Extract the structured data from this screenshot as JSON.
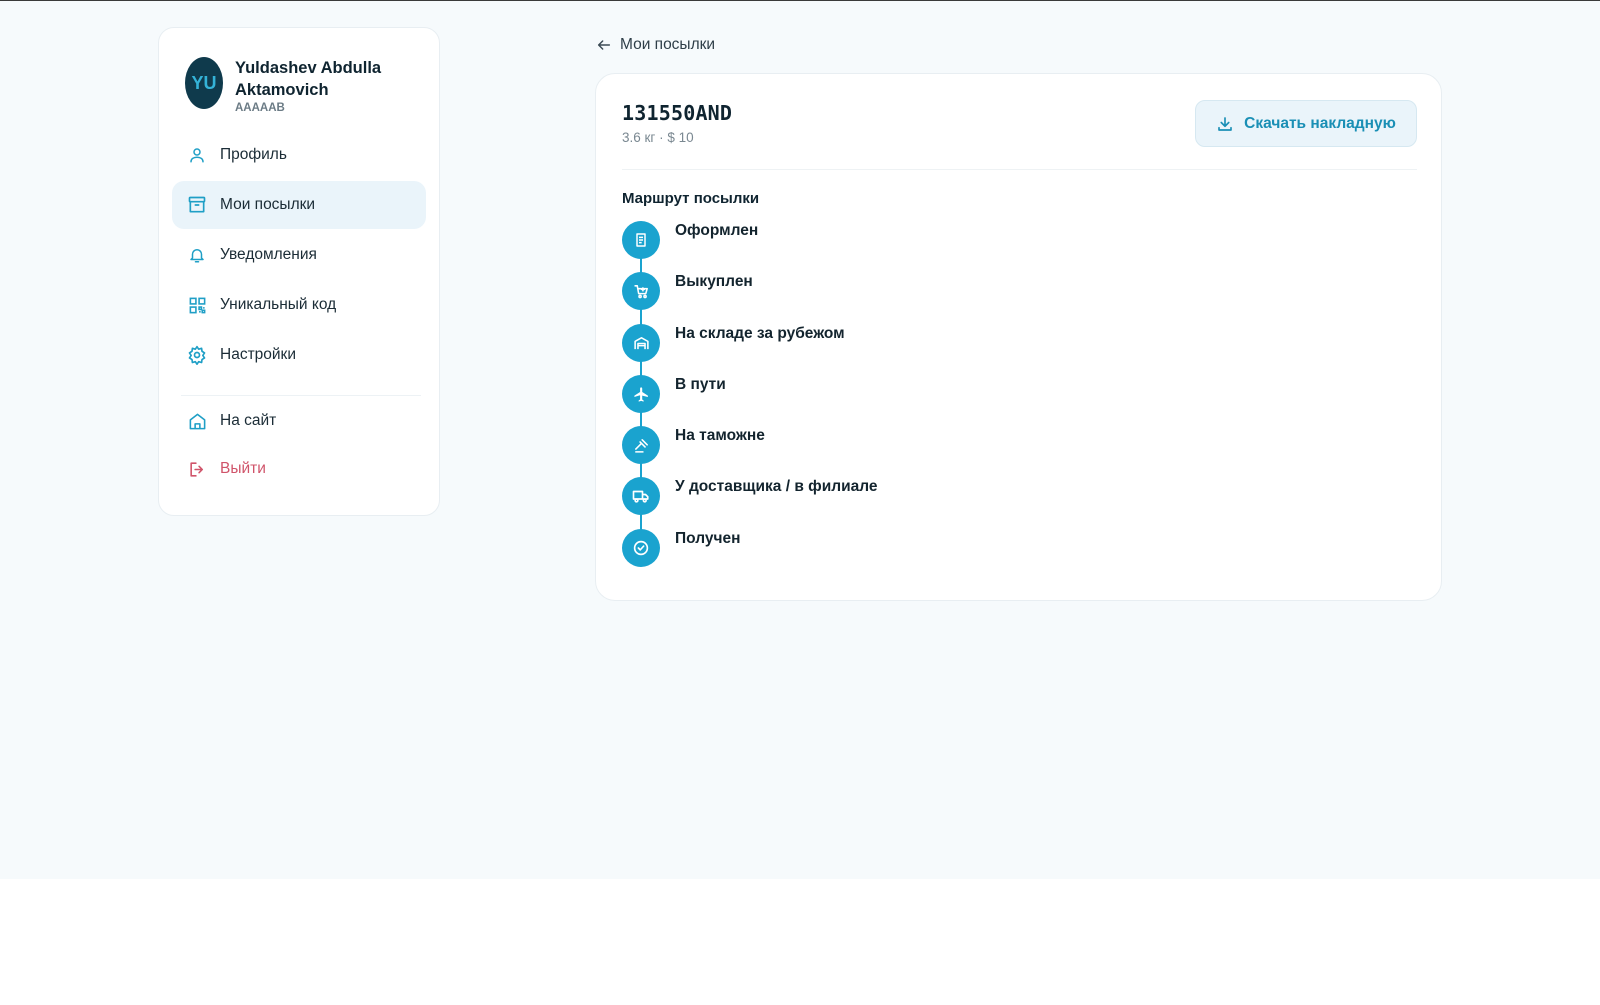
{
  "user": {
    "initials": "YU",
    "name": "Yuldashev Abdulla Aktamovich",
    "code": "AAAAAB"
  },
  "sidebar": {
    "items": [
      {
        "label": "Профиль",
        "icon": "user-icon"
      },
      {
        "label": "Мои посылки",
        "icon": "archive-box-icon",
        "active": true
      },
      {
        "label": "Уведомления",
        "icon": "bell-icon"
      },
      {
        "label": "Уникальный код",
        "icon": "qr-code-icon"
      },
      {
        "label": "Настройки",
        "icon": "gear-icon"
      },
      {
        "label": "На сайт",
        "icon": "home-icon"
      },
      {
        "label": "Выйти",
        "icon": "logout-icon"
      }
    ]
  },
  "header": {
    "back_label": "Мои посылки"
  },
  "parcel": {
    "id": "131550AND",
    "meta": "3.6 кг · $ 10",
    "download_label": "Скачать накладную"
  },
  "route": {
    "title": "Маршрут посылки",
    "steps": [
      {
        "label": "Оформлен",
        "icon": "document-icon"
      },
      {
        "label": "Выкуплен",
        "icon": "cart-icon"
      },
      {
        "label": "На складе за рубежом",
        "icon": "warehouse-icon"
      },
      {
        "label": "В пути",
        "icon": "airplane-icon"
      },
      {
        "label": "На таможне",
        "icon": "gavel-icon"
      },
      {
        "label": "У доставщика / в филиале",
        "icon": "truck-icon"
      },
      {
        "label": "Получен",
        "icon": "check-circle-icon"
      }
    ]
  },
  "colors": {
    "accent": "#1aa3cf",
    "active_bg": "#eaf4fa",
    "logout": "#d0546a",
    "avatar_bg": "#0f3a4c"
  }
}
